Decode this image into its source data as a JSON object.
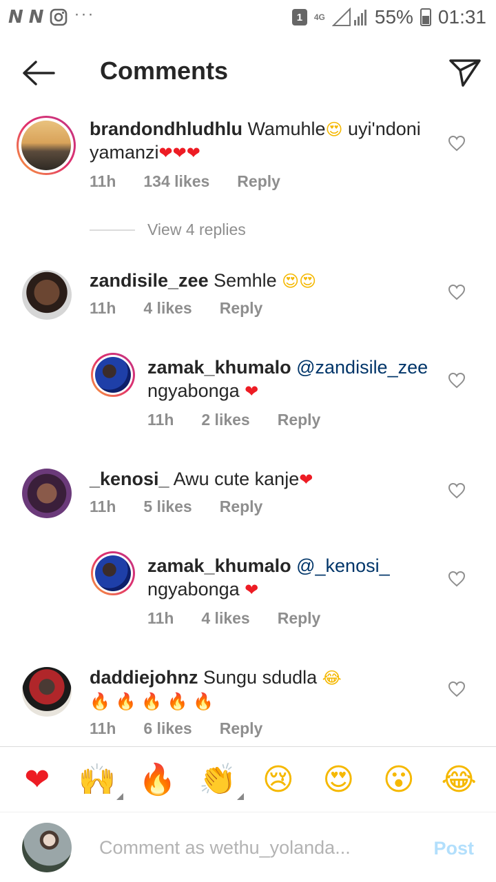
{
  "status_bar": {
    "sim_badge": "1",
    "network": "4G",
    "battery": "55%",
    "time": "01:31",
    "dots": "···"
  },
  "header": {
    "title": "Comments"
  },
  "comments": [
    {
      "username": "brandondhludhlu",
      "text_before": " Wamuhle",
      "text_after": " uyi'ndoni yamanzi",
      "time": "11h",
      "likes": "134 likes",
      "reply": "Reply",
      "view_replies": "View 4 replies"
    },
    {
      "username": "zandisile_zee",
      "text": " Semhle ",
      "time": "11h",
      "likes": "4 likes",
      "reply": "Reply"
    },
    {
      "username": "zamak_khumalo",
      "mention": "@zandisile_zee",
      "text": "ngyabonga ",
      "time": "11h",
      "likes": "2 likes",
      "reply": "Reply"
    },
    {
      "username": "_kenosi_",
      "text": " Awu cute kanje",
      "time": "11h",
      "likes": "5 likes",
      "reply": "Reply"
    },
    {
      "username": "zamak_khumalo",
      "mention": "@_kenosi_",
      "text": "ngyabonga ",
      "time": "11h",
      "likes": "4 likes",
      "reply": "Reply"
    },
    {
      "username": "daddiejohnz",
      "text": " Sungu sdudla ",
      "time": "11h",
      "likes": "6 likes",
      "reply": "Reply"
    }
  ],
  "emoji_bar": [
    "❤",
    "🙌",
    "🔥",
    "👏",
    "😢",
    "😍",
    "😮",
    "😂"
  ],
  "composer": {
    "placeholder": "Comment as wethu_yolanda...",
    "post_label": "Post"
  },
  "colors": {
    "text": "#262626",
    "meta": "#8e8e8e",
    "mention": "#003569",
    "post_disabled": "#b2dffc",
    "heart_red": "#ed1c24"
  }
}
